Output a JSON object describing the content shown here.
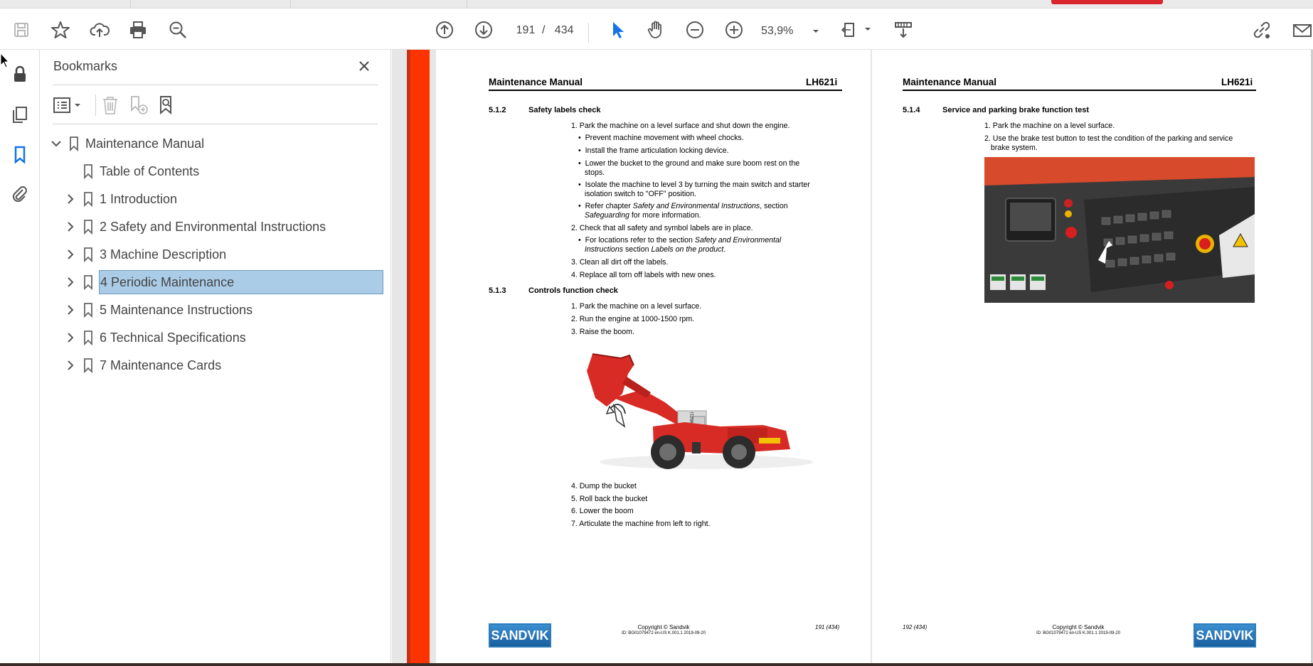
{
  "toolbar": {
    "page_current": "191",
    "page_separator": "/",
    "page_total": "434",
    "zoom": "53,9%"
  },
  "bookmarks": {
    "title": "Bookmarks",
    "items": [
      {
        "label": "Maintenance Manual",
        "expanded": true,
        "has_children": true,
        "level": 0
      },
      {
        "label": "Table of Contents",
        "has_children": false,
        "level": 1
      },
      {
        "label": "1 Introduction",
        "has_children": true,
        "level": 1
      },
      {
        "label": "2 Safety and Environmental Instructions",
        "has_children": true,
        "level": 1
      },
      {
        "label": "3 Machine Description",
        "has_children": true,
        "level": 1
      },
      {
        "label": "4 Periodic Maintenance",
        "has_children": true,
        "level": 1,
        "selected": true
      },
      {
        "label": "5 Maintenance Instructions",
        "has_children": true,
        "level": 1
      },
      {
        "label": "6 Technical Specifications",
        "has_children": true,
        "level": 1
      },
      {
        "label": "7 Maintenance Cards",
        "has_children": true,
        "level": 1
      }
    ]
  },
  "page_left": {
    "header_title": "Maintenance Manual",
    "header_model": "LH621i",
    "section1_num": "5.1.2",
    "section1_title": "Safety labels check",
    "s1_step1": "1. Park the machine on a level surface and shut down the engine.",
    "s1_b1": "Prevent machine movement with wheel chocks.",
    "s1_b2": "Install the frame articulation locking device.",
    "s1_b3a": "Lower the bucket to the ground and make sure boom rest on the",
    "s1_b3b": "stops.",
    "s1_b4a": "Isolate the machine to level 3 by turning the main switch and starter",
    "s1_b4b": "isolation switch to \"OFF\" position.",
    "s1_b5a_pre": "Refer chapter ",
    "s1_b5a_it": "Safety and Environmental Instructions",
    "s1_b5a_post": ", section",
    "s1_b5b_it": "Safeguarding",
    "s1_b5b_post": " for more information.",
    "s1_step2": "2. Check that all safety and symbol labels are in place.",
    "s1_b6a_pre": "For locations refer to the section ",
    "s1_b6a_it": "Safety and Environmental",
    "s1_b6b_it1": "Instructions",
    "s1_b6b_mid": " section ",
    "s1_b6b_it2": "Labels on the product",
    "s1_b6b_post": ".",
    "s1_step3": "3. Clean all dirt off the labels.",
    "s1_step4": "4. Replace all torn off labels with new ones.",
    "section2_num": "5.1.3",
    "section2_title": "Controls function check",
    "s2_step1": "1. Park the machine on a level surface.",
    "s2_step2": "2. Run the engine at 1000-1500 rpm.",
    "s2_step3": "3. Raise the boom.",
    "s2_step4": "4. Dump the bucket",
    "s2_step5": "5. Roll back the bucket",
    "s2_step6": "6. Lower the boom",
    "s2_step7": "7. Articulate the machine from left to right.",
    "machine_label": "LH621i",
    "logo": "SANDVIK",
    "copyright": "Copyright © Sandvik",
    "doc_id": "ID: BG01079472 en-US K.001.1 2019-09-20",
    "page_num": "191 (434)"
  },
  "page_right": {
    "header_title": "Maintenance Manual",
    "header_model": "LH621i",
    "section_num": "5.1.4",
    "section_title": "Service and parking brake function test",
    "step1": "1. Park the machine on a level surface.",
    "step2a": "2. Use the brake test button to test the condition of the parking and service",
    "step2b": "brake system.",
    "logo": "SANDVIK",
    "copyright": "Copyright © Sandvik",
    "doc_id": "ID: BG01079472 en-US K.001.1 2019-09-20",
    "page_num": "192 (434)"
  },
  "colors": {
    "accent_blue": "#1473e6",
    "selection": "#aacce6",
    "page_bar": "#ff3300",
    "machine_red": "#d82b25"
  }
}
